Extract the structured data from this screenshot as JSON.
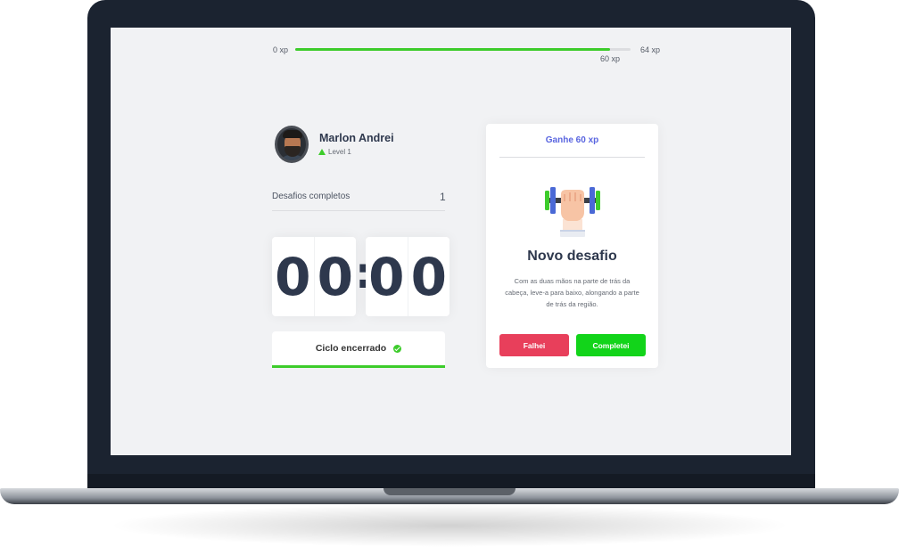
{
  "xp": {
    "min_label": "0 xp",
    "max_label": "64 xp",
    "current_label": "60 xp",
    "progress": 0.94
  },
  "profile": {
    "name": "Marlon Andrei",
    "level": "Level 1"
  },
  "challenges": {
    "label": "Desafios completos",
    "count": "1"
  },
  "countdown": {
    "minutes": [
      "0",
      "0"
    ],
    "seconds": [
      "0",
      "0"
    ],
    "separator": ":"
  },
  "cycle_button": {
    "label": "Ciclo encerrado"
  },
  "challenge_card": {
    "header": "Ganhe 60 xp",
    "title": "Novo desafio",
    "description": "Com as duas mãos na parte de trás da cabeça, leve-a para baixo, alongando a parte de trás da região.",
    "fail_label": "Falhei",
    "success_label": "Completei",
    "icon": "dumbbell-icon"
  },
  "colors": {
    "accent_green": "#3dcc2b",
    "accent_blue": "#5965e0",
    "danger_red": "#e83f5b",
    "text_dark": "#2e384d"
  }
}
